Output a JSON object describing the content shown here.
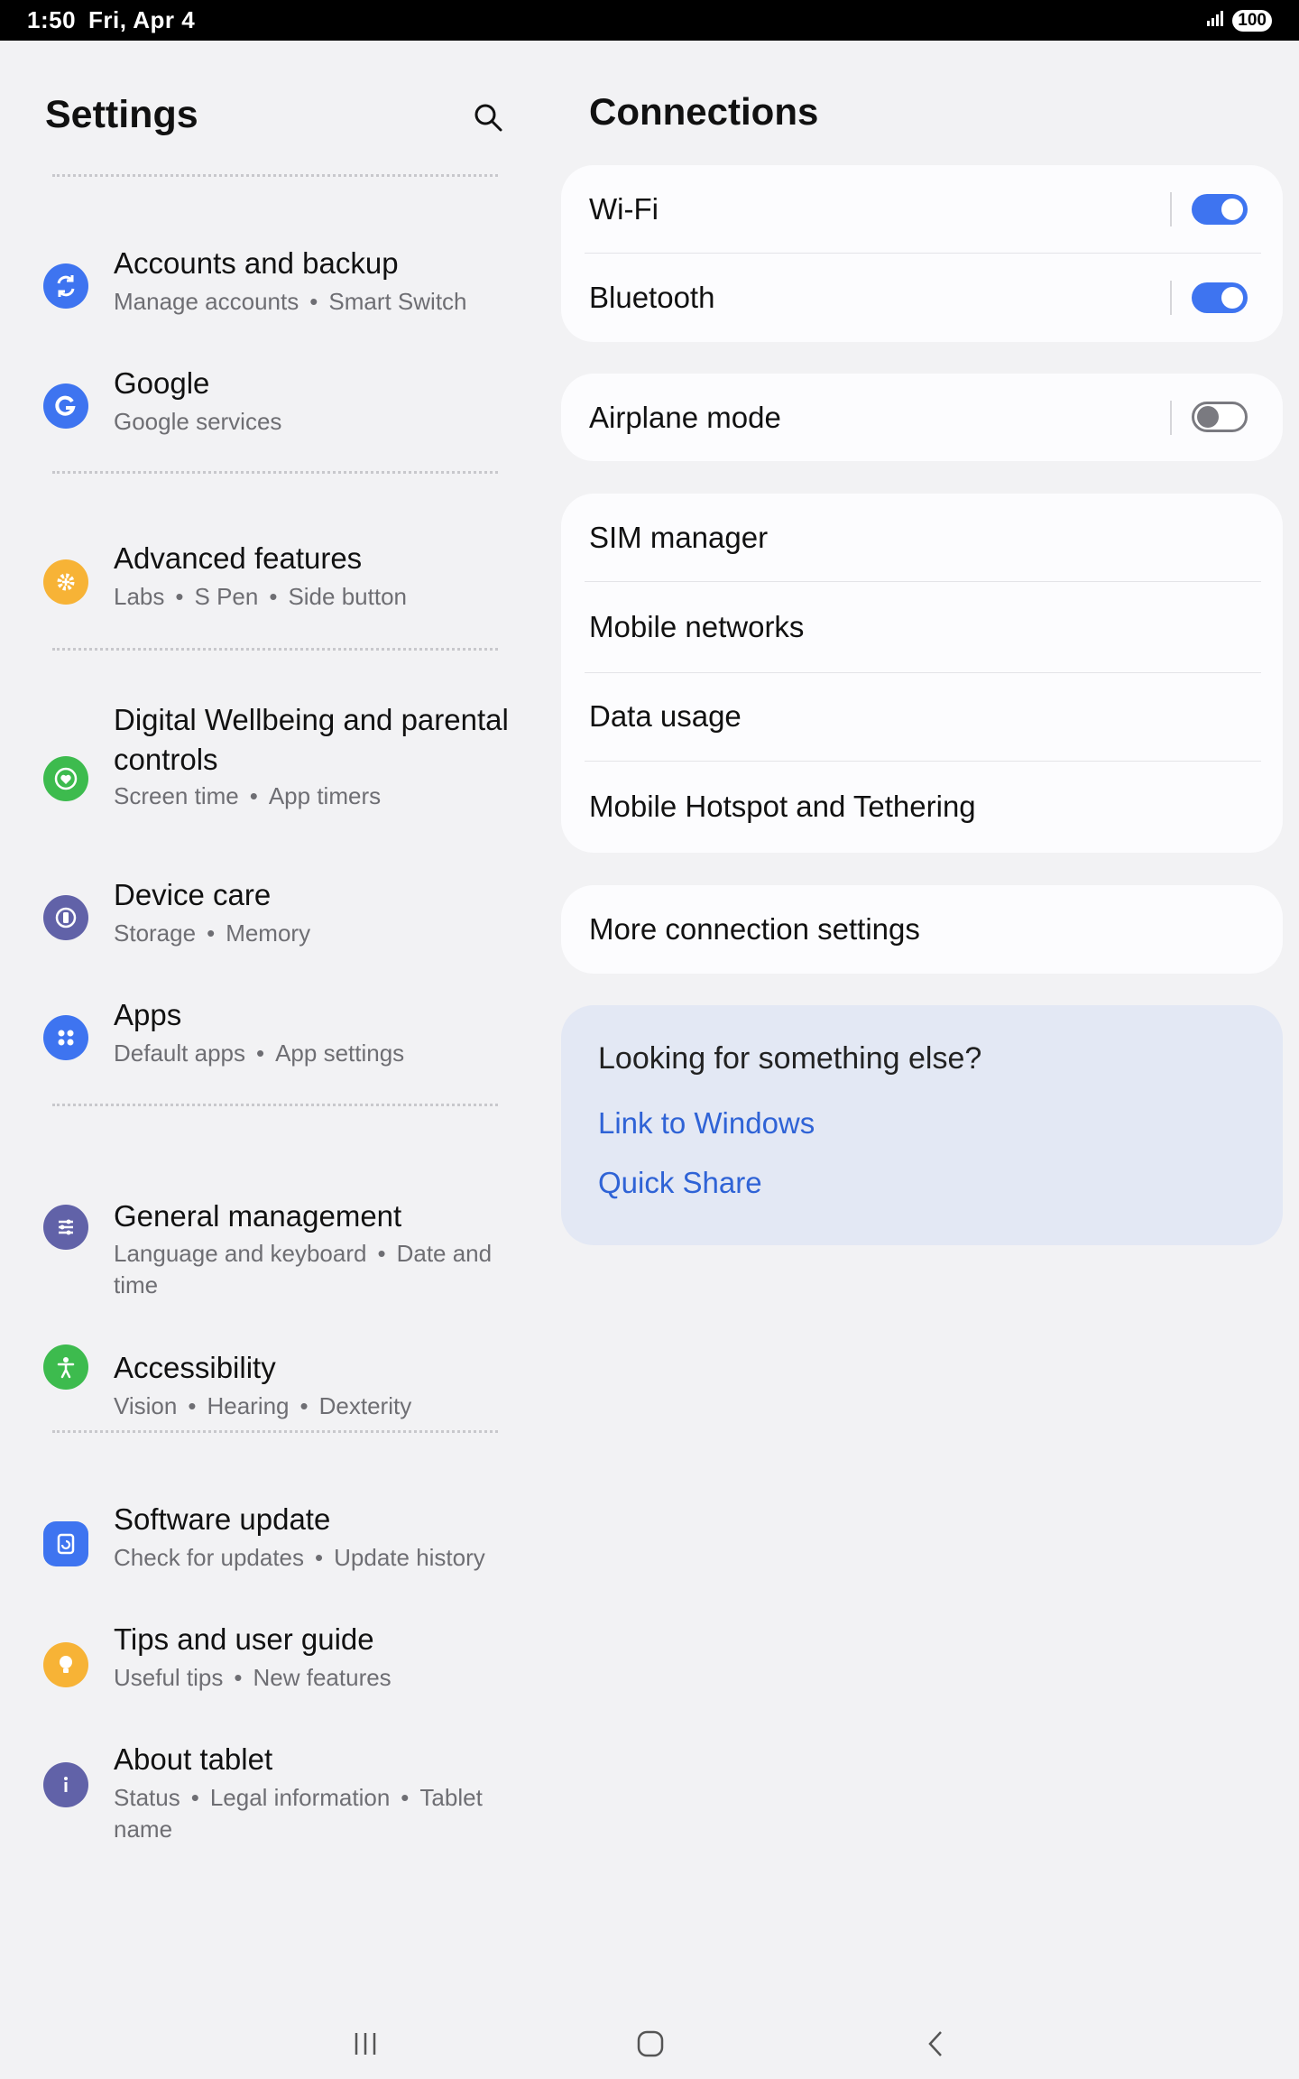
{
  "status_bar": {
    "time": "1:50",
    "date": "Fri, Apr 4",
    "battery": "100"
  },
  "settings": {
    "title": "Settings",
    "items": [
      {
        "title": "Accounts and backup",
        "subs": [
          "Manage accounts",
          "Smart Switch"
        ],
        "icon": "sync-icon",
        "color": "#3e74f0"
      },
      {
        "title": "Google",
        "subs": [
          "Google services"
        ],
        "icon": "google-icon",
        "color": "#3e74f0"
      },
      {
        "title": "Advanced features",
        "subs": [
          "Labs",
          "S Pen",
          "Side button"
        ],
        "icon": "gear-plus-icon",
        "color": "#f7b336"
      },
      {
        "title": "Digital Wellbeing and parental controls",
        "subs": [
          "Screen time",
          "App timers"
        ],
        "icon": "heart-circle-icon",
        "color": "#3dbb4e"
      },
      {
        "title": "Device care",
        "subs": [
          "Storage",
          "Memory"
        ],
        "icon": "device-care-icon",
        "color": "#6162a8"
      },
      {
        "title": "Apps",
        "subs": [
          "Default apps",
          "App settings"
        ],
        "icon": "apps-grid-icon",
        "color": "#3e74f0"
      },
      {
        "title": "General management",
        "subs": [
          "Language and keyboard",
          "Date and time"
        ],
        "icon": "sliders-icon",
        "color": "#6162a8"
      },
      {
        "title": "Accessibility",
        "subs": [
          "Vision",
          "Hearing",
          "Dexterity"
        ],
        "icon": "accessibility-icon",
        "color": "#3dbb4e"
      },
      {
        "title": "Software update",
        "subs": [
          "Check for updates",
          "Update history"
        ],
        "icon": "software-update-icon",
        "color": "#3e74f0"
      },
      {
        "title": "Tips and user guide",
        "subs": [
          "Useful tips",
          "New features"
        ],
        "icon": "lightbulb-icon",
        "color": "#f7b336"
      },
      {
        "title": "About tablet",
        "subs": [
          "Status",
          "Legal information",
          "Tablet name"
        ],
        "icon": "info-icon",
        "color": "#6162a8"
      }
    ]
  },
  "connections": {
    "title": "Connections",
    "wifi": {
      "label": "Wi-Fi",
      "on": true
    },
    "bluetooth": {
      "label": "Bluetooth",
      "on": true
    },
    "airplane": {
      "label": "Airplane mode",
      "on": false
    },
    "sim_manager": "SIM manager",
    "mobile_networks": "Mobile networks",
    "data_usage": "Data usage",
    "hotspot": "Mobile Hotspot and Tethering",
    "more": "More connection settings",
    "suggest": {
      "title": "Looking for something else?",
      "links": [
        "Link to Windows",
        "Quick Share"
      ]
    }
  },
  "colors": {
    "accent": "#3e74f0",
    "link": "#2f63d6",
    "background": "#f2f2f4",
    "card": "#fcfcfe"
  }
}
